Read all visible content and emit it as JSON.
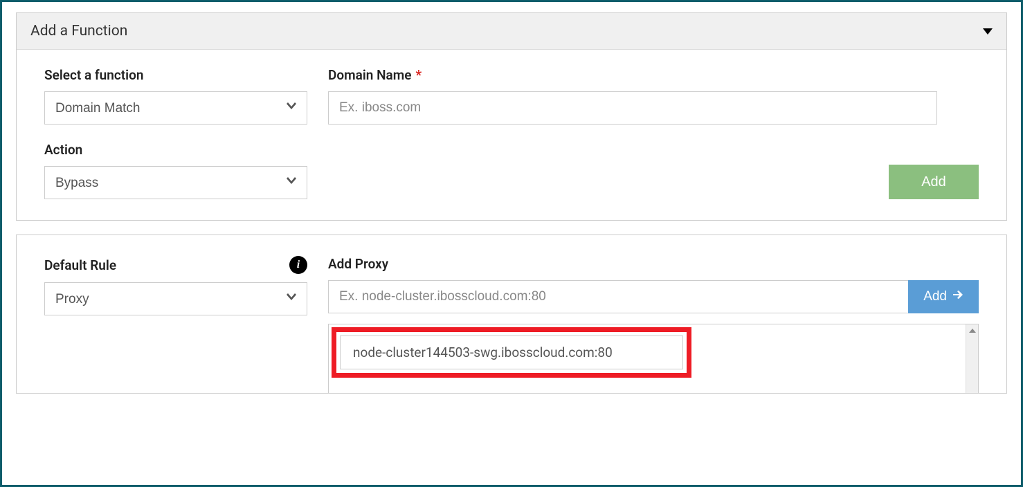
{
  "addFunction": {
    "panelTitle": "Add a Function",
    "selectFunction": {
      "label": "Select a function",
      "value": "Domain Match"
    },
    "domainName": {
      "label": "Domain Name",
      "placeholder": "Ex. iboss.com"
    },
    "action": {
      "label": "Action",
      "value": "Bypass"
    },
    "addButton": "Add"
  },
  "defaultRule": {
    "label": "Default Rule",
    "value": "Proxy"
  },
  "addProxy": {
    "label": "Add Proxy",
    "placeholder": "Ex. node-cluster.ibosscloud.com:80",
    "addButton": "Add",
    "items": [
      "node-cluster144503-swg.ibosscloud.com:80"
    ]
  }
}
